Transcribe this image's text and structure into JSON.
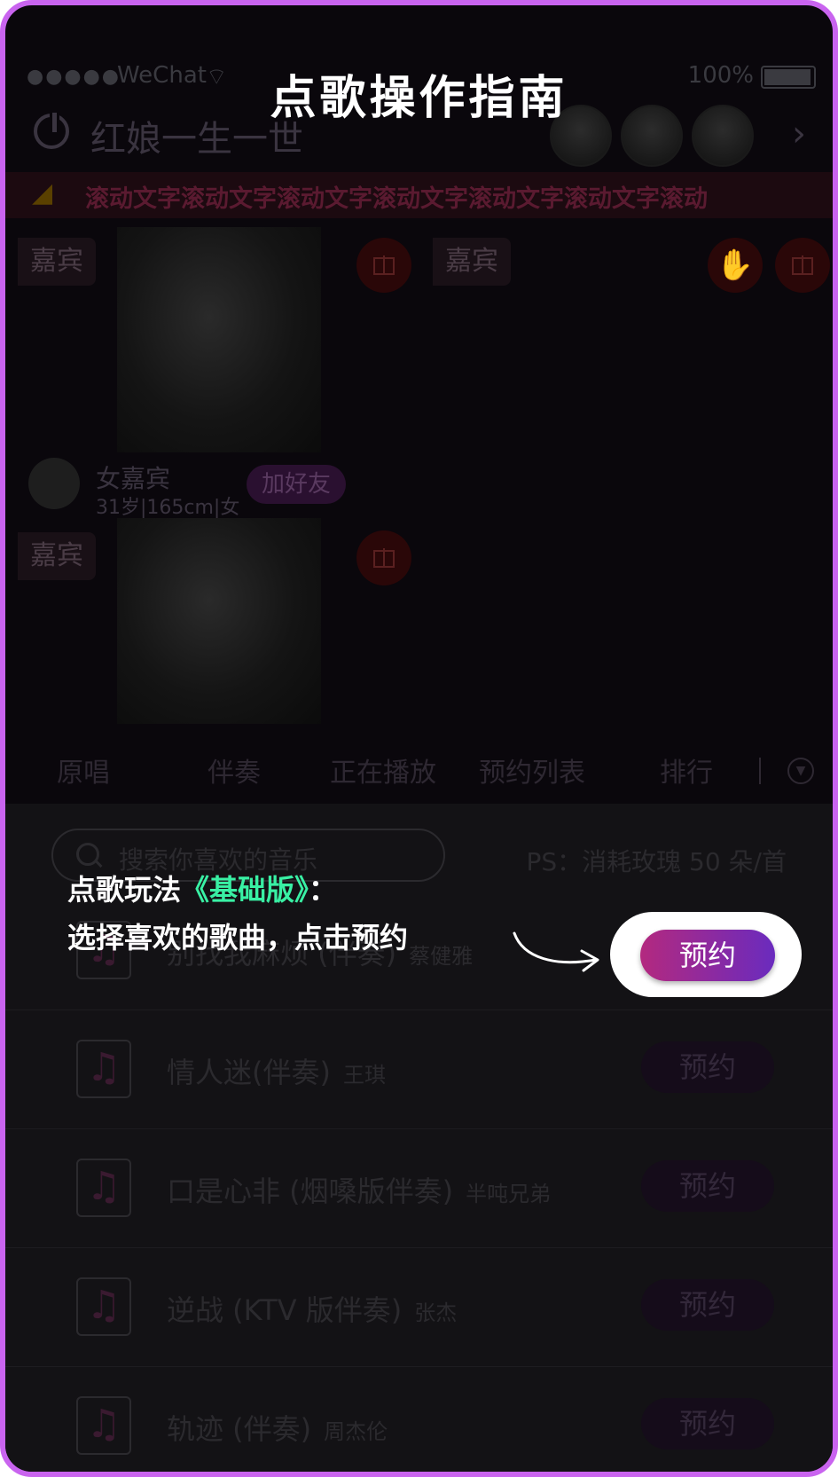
{
  "status_bar": {
    "signal": "●●●●●",
    "carrier": "WeChat",
    "wifi": "wifi-icon",
    "battery": "100%"
  },
  "header": {
    "title": "红娘一生一世",
    "next_icon": "chevron-right-icon"
  },
  "marquee": {
    "text": "滚动文字滚动文字滚动文字滚动文字滚动文字滚动文字滚动"
  },
  "tiles": {
    "guest_label": "嘉宾",
    "host_name": "女嘉宾",
    "host_info": "31岁|165cm|女",
    "add_friend": "加好友"
  },
  "tabs": [
    "原唱",
    "伴奏",
    "正在播放",
    "预约列表",
    "排行"
  ],
  "panel": {
    "search_placeholder": "搜索你喜欢的音乐",
    "ps_note": "PS：消耗玫瑰 50 朵/首",
    "book_label": "预约",
    "songs": [
      {
        "title": "别找我麻烦 (伴奏)",
        "artist": "蔡健雅"
      },
      {
        "title": "情人迷(伴奏)",
        "artist": "王琪"
      },
      {
        "title": "口是心非 (烟嗓版伴奏)",
        "artist": "半吨兄弟"
      },
      {
        "title": "逆战 (KTV 版伴奏)",
        "artist": "张杰"
      },
      {
        "title": "轨迹 (伴奏)",
        "artist": "周杰伦"
      }
    ]
  },
  "guide": {
    "title": "点歌操作指南",
    "line1_prefix": "点歌玩法",
    "line1_highlight": "《基础版》",
    "line1_suffix": "：",
    "line2": "选择喜欢的歌曲，点击预约",
    "button_label": "预约",
    "colors": {
      "highlight": "#39f0a4",
      "frame": "#c964ef",
      "button_start": "#b3297f",
      "button_end": "#6a2bbe"
    }
  }
}
